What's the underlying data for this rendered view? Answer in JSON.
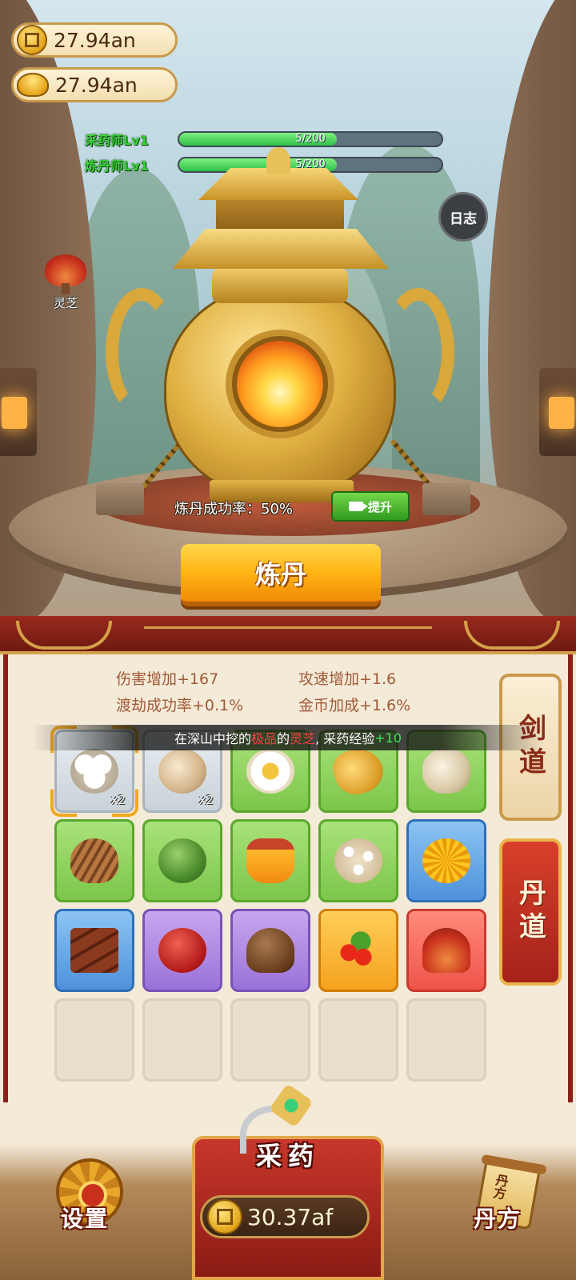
{
  "currencies": {
    "coins": "27.94an",
    "ingots": "27.94an"
  },
  "levels": [
    {
      "label": "采药师Lv1",
      "progress_text": "5/200",
      "progress": 0.6
    },
    {
      "label": "炼丹师Lv1",
      "progress_text": "5/200",
      "progress": 0.6
    }
  ],
  "log_button": "日志",
  "floating_herb": {
    "label": "灵芝",
    "icon": "lingzhi-icon"
  },
  "cauldron": {
    "success_rate_text": "炼丹成功率：50%",
    "upgrade_label": "提升",
    "alchemy_button": "炼丹"
  },
  "stats": [
    "伤害增加+167",
    "攻速增加+1.6",
    "渡劫成功率+0.1%",
    "金币加成+1.6%"
  ],
  "toast": {
    "part1": "在深山中挖的",
    "quality": "极品",
    "part2": "的",
    "herb": "灵芝",
    "part3": ", 采药经验",
    "exp": "+10"
  },
  "side_tabs": {
    "sword": "剑道",
    "dan": "丹道"
  },
  "inventory": [
    {
      "icon": "cotton-icon",
      "rarity": "white",
      "qty": "x2",
      "selected": true
    },
    {
      "icon": "nut-icon",
      "rarity": "white",
      "qty": "x2"
    },
    {
      "icon": "flower-icon",
      "rarity": "green"
    },
    {
      "icon": "ginseng-icon",
      "rarity": "green"
    },
    {
      "icon": "rock-herb-icon",
      "rarity": "green"
    },
    {
      "icon": "wood-root-icon",
      "rarity": "green"
    },
    {
      "icon": "melon-icon",
      "rarity": "green"
    },
    {
      "icon": "honey-jar-icon",
      "rarity": "green"
    },
    {
      "icon": "grain-icon",
      "rarity": "green"
    },
    {
      "icon": "chrysanthemum-icon",
      "rarity": "blue"
    },
    {
      "icon": "bark-icon",
      "rarity": "blue"
    },
    {
      "icon": "red-date-icon",
      "rarity": "purple"
    },
    {
      "icon": "mushroom-icon",
      "rarity": "purple"
    },
    {
      "icon": "goji-berry-icon",
      "rarity": "orange"
    },
    {
      "icon": "lingzhi-icon",
      "rarity": "red"
    },
    {
      "icon": "empty-slot",
      "rarity": "empty"
    },
    {
      "icon": "empty-slot",
      "rarity": "empty"
    },
    {
      "icon": "empty-slot",
      "rarity": "empty"
    },
    {
      "icon": "empty-slot",
      "rarity": "empty"
    },
    {
      "icon": "empty-slot",
      "rarity": "empty"
    }
  ],
  "bottom": {
    "settings_label": "设置",
    "gather_label": "采药",
    "gather_cost": "30.37af",
    "recipe_label": "丹方",
    "recipe_scroll_text": "丹方"
  },
  "colors": {
    "level_text": "#3bd13b",
    "toast_quality": "#ff4040",
    "toast_exp": "#3ee05a",
    "alchemy_button": "#ffb414",
    "upgrade_button": "#2f9a1e"
  }
}
